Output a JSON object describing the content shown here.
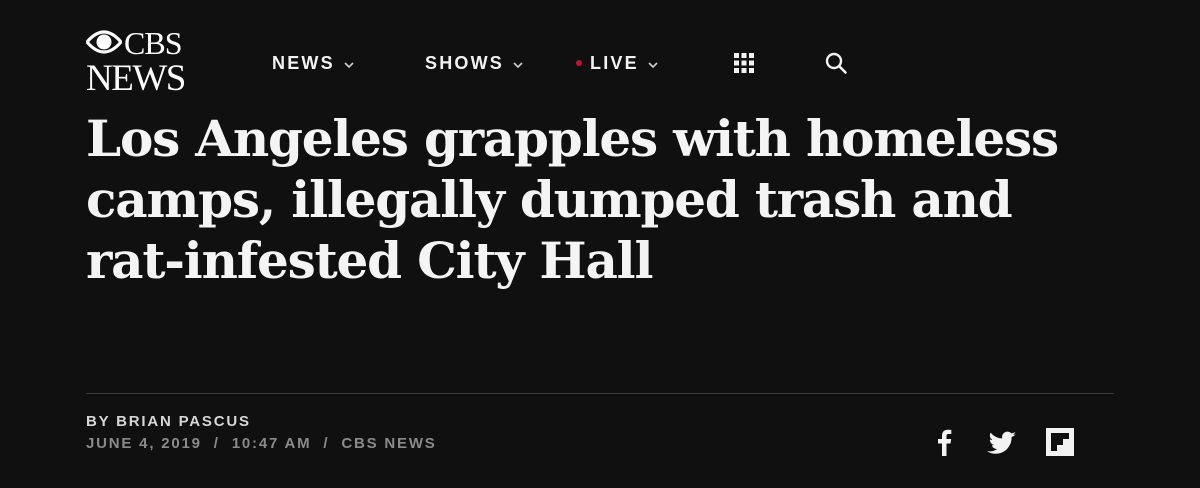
{
  "header": {
    "logo": {
      "line1": "CBS",
      "line2": "NEWS"
    },
    "nav": [
      {
        "label": "NEWS",
        "has_dropdown": true
      },
      {
        "label": "SHOWS",
        "has_dropdown": true
      },
      {
        "label": "LIVE",
        "has_dropdown": true,
        "live_dot": true
      }
    ],
    "icons": {
      "apps": "grid-menu-icon",
      "search": "search-icon"
    }
  },
  "article": {
    "headline": "Los Angeles grapples with homeless camps, illegally dumped trash and rat-infested City Hall",
    "byline": "BY BRIAN PASCUS",
    "meta": {
      "date": "JUNE 4, 2019",
      "time": "10:47 AM",
      "source": "CBS NEWS",
      "separator": "/"
    }
  },
  "share": {
    "icons": [
      "facebook-icon",
      "twitter-icon",
      "flipboard-icon"
    ]
  },
  "colors": {
    "background": "#101010",
    "text": "#f2f2f2",
    "meta": "#8a8a8a",
    "live_dot": "#c8102e"
  }
}
